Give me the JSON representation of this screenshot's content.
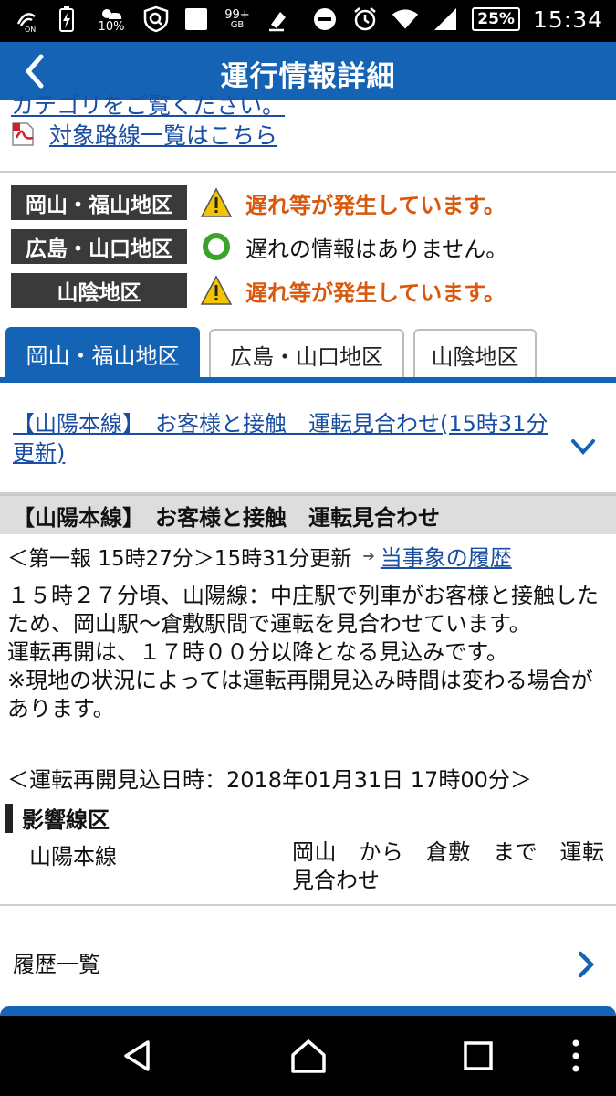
{
  "status_bar": {
    "nfc_label": "ON",
    "weather_percent": "10%",
    "data_badge": "99+",
    "data_unit": "GB",
    "battery": "25%",
    "time": "15:34",
    "icons": [
      "nfc-icon",
      "battery-charging-icon",
      "weather-icon",
      "shield-icon",
      "square-icon",
      "data-usage-icon",
      "share-icon",
      "dnd-icon",
      "alarm-icon",
      "wifi-icon",
      "signal-icon",
      "battery-icon"
    ]
  },
  "header": {
    "title": "運行情報詳細",
    "back_icon": "chevron-left-icon"
  },
  "top_partial_text": "カテゴリをご覧ください。",
  "pdf_link": {
    "icon": "pdf-icon",
    "label": "対象路線一覧はこちら"
  },
  "regions": [
    {
      "name": "岡山・福山地区",
      "icon": "warning-icon",
      "status": "遅れ等が発生しています。",
      "status_color": "#d9580c"
    },
    {
      "name": "広島・山口地区",
      "icon": "ok-circle-icon",
      "status": "遅れの情報はありません。",
      "status_color": "#111111"
    },
    {
      "name": "山陰地区",
      "icon": "warning-icon",
      "status": "遅れ等が発生しています。",
      "status_color": "#d9580c"
    }
  ],
  "tabs": [
    {
      "label": "岡山・福山地区",
      "active": true
    },
    {
      "label": "広島・山口地区",
      "active": false
    },
    {
      "label": "山陰地区",
      "active": false
    }
  ],
  "incident_link": "【山陽本線】　お客様と接触　運転見合わせ(15時31分更新)",
  "detail": {
    "heading": "【山陽本線】　お客様と接触　運転見合わせ",
    "update_prefix": "＜第一報 15時27分＞15時31分更新",
    "history_link": "当事象の履歴",
    "paragraphs": [
      "１５時２７分頃、山陽線：中庄駅で列車がお客様と接触したため、岡山駅～倉敷駅間で運転を見合わせています。",
      "運転再開は、１７時００分以降となる見込みです。",
      "※現地の状況によっては運転再開見込み時間は変わる場合があります。"
    ],
    "resume_estimate": "＜運転再開見込日時：2018年01月31日 17時00分＞",
    "affected_heading": "影響線区",
    "affected_line": "山陽本線",
    "affected_detail": "岡山　から　倉敷　まで　運転見合わせ"
  },
  "history_list": {
    "label": "履歴一覧"
  },
  "colors": {
    "header_blue": "#1463b4",
    "warn_orange": "#d9580c",
    "link_blue": "#1a4ea3",
    "ok_green": "#3ca32a"
  }
}
